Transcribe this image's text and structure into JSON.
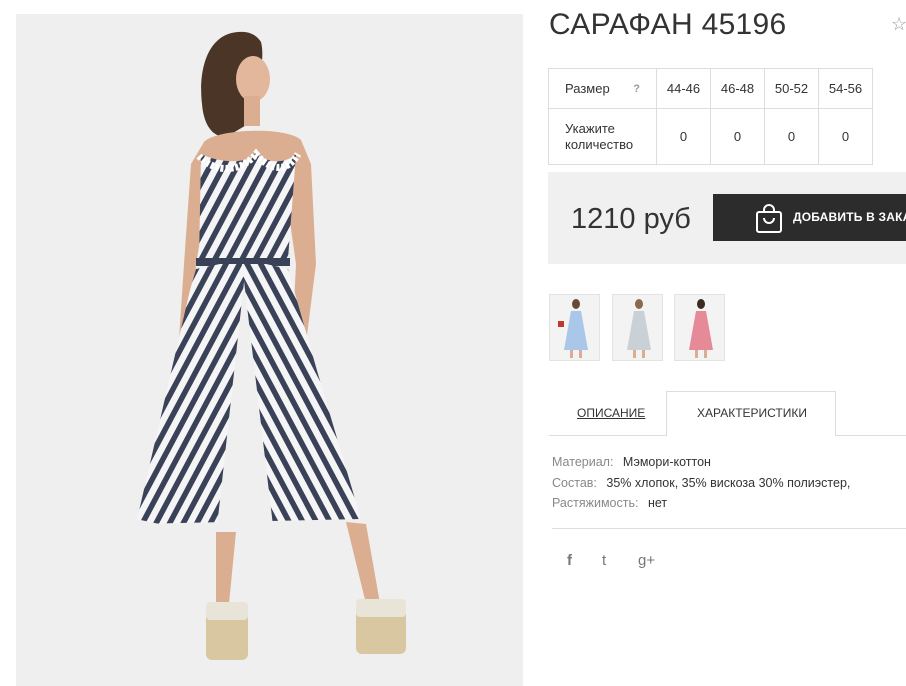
{
  "product": {
    "title": "САРАФАН 45196",
    "favorite_icon": "star-outline-icon",
    "photo_icon": "striped-dress-photo",
    "colors": {
      "stripe": "#3a4258",
      "photo_bg": "#efefef",
      "button_bg": "#2c2c2c",
      "price_bg": "#f0f0f0"
    }
  },
  "sizes": {
    "header_label": "Размер",
    "help": "?",
    "columns": [
      "44-46",
      "46-48",
      "50-52",
      "54-56"
    ],
    "qty_label": "Укажите количество",
    "quantities": [
      "0",
      "0",
      "0",
      "0"
    ]
  },
  "purchase": {
    "price": "1210 руб",
    "add_button": "ДОБАВИТЬ В ЗАКАЗ",
    "bag_icon": "shopping-bag-icon"
  },
  "thumbnails": [
    {
      "name": "thumb-blue-dress",
      "color": "#a9c7e8"
    },
    {
      "name": "thumb-grey-dress",
      "color": "#c9d0d6"
    },
    {
      "name": "thumb-pink-dress",
      "color": "#e68a98"
    }
  ],
  "tabs": {
    "description": "ОПИСАНИЕ",
    "characteristics": "ХАРАКТЕРИСТИКИ"
  },
  "specs": {
    "material_label": "Материал:",
    "material_value": "Мэмори-коттон",
    "composition_label": "Состав:",
    "composition_value": "35% хлопок, 35% вискоза 30% полиэстер,",
    "stretch_label": "Растяжимость:",
    "stretch_value": "нет"
  },
  "social": {
    "facebook": "f",
    "twitter": "t",
    "googleplus": "g+"
  }
}
